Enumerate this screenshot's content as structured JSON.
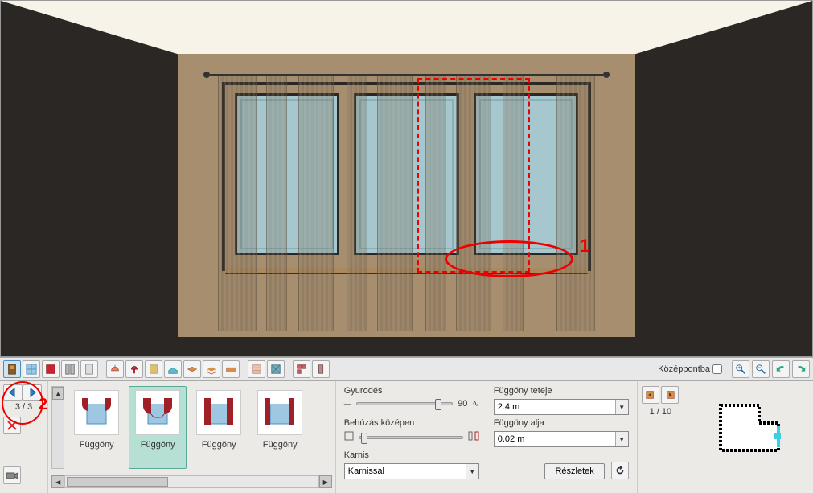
{
  "toolbar": {
    "center_label": "Középpontba",
    "tabs": [
      "door",
      "window-grid",
      "curtain",
      "door-panel",
      "panel",
      "lamp-ceil",
      "lamp-table",
      "rug",
      "material",
      "floor",
      "cushion",
      "sofa",
      "wall-tile",
      "wall-pattern",
      "brick",
      "column",
      "beam"
    ]
  },
  "catalog_nav": {
    "page": "3 / 3",
    "items": [
      {
        "label": "Függöny"
      },
      {
        "label": "Függöny"
      },
      {
        "label": "Függöny"
      },
      {
        "label": "Függöny"
      }
    ],
    "selected_index": 1
  },
  "params": {
    "gy_label": "Gyurodés",
    "gy_max": "90",
    "behuzas_label": "Behúzás középen",
    "karnis_label": "Karnis",
    "karnis_value": "Karnissal",
    "top_label": "Függöny teteje",
    "top_value": "2.4 m",
    "bottom_label": "Függöny alja",
    "bottom_value": "0.02 m",
    "details_button": "Részletek"
  },
  "right_nav": {
    "page": "1 / 10"
  },
  "annotations": {
    "num1": "1",
    "num2": "2"
  }
}
